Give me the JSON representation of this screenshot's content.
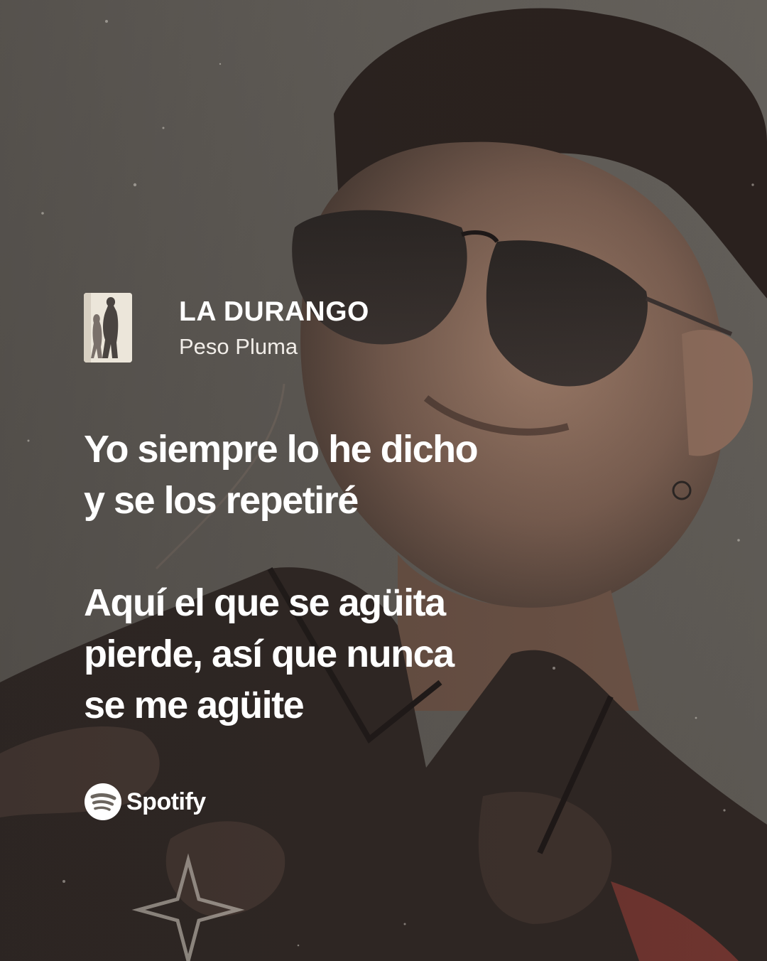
{
  "track": {
    "title": "LA DURANGO",
    "artist": "Peso Pluma",
    "cover_art": "album-cover-image"
  },
  "lyrics": [
    {
      "lines": [
        "Yo siempre lo he dicho",
        "y se los repetiré"
      ]
    },
    {
      "lines": [
        "Aquí el que se agüita",
        "pierde, así que nunca",
        "se me agüite"
      ]
    }
  ],
  "brand": {
    "icon": "spotify-logo-icon",
    "name": "Spotify"
  },
  "colors": {
    "text": "#ffffff",
    "background": "#5e5a55"
  }
}
